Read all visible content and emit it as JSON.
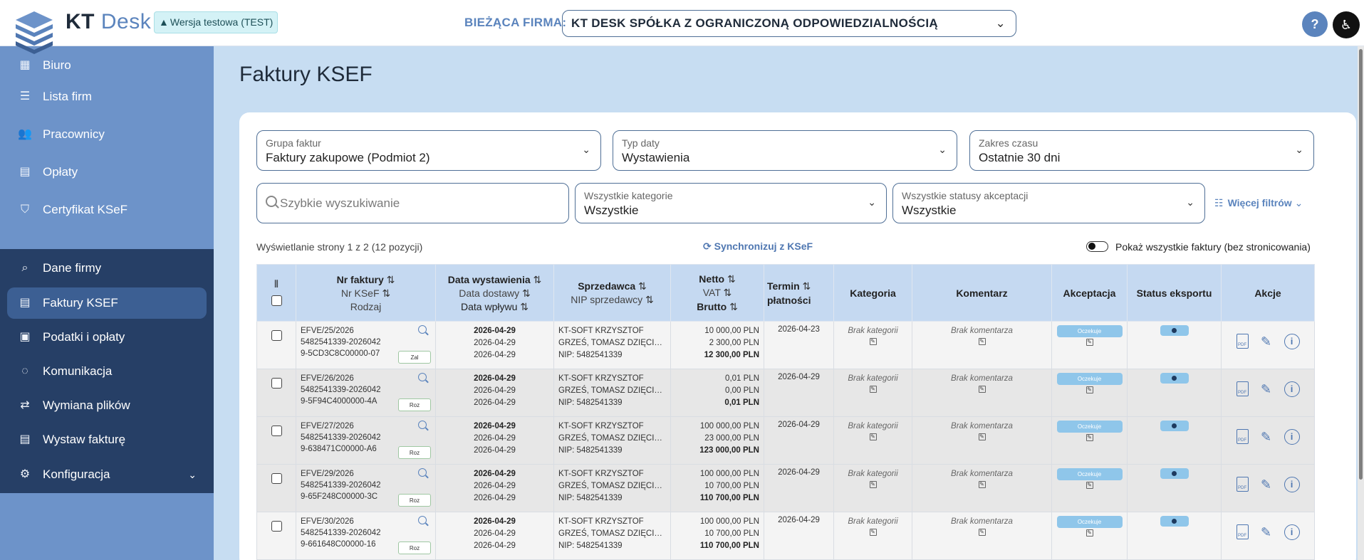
{
  "header": {
    "brand_main": "KT",
    "brand_accent": "Desk",
    "test_badge": "Wersja testowa (TEST)",
    "company_label": "BIEŻĄCA FIRMA:",
    "company_value": "KT DESK SPÓŁKA Z OGRANICZONĄ ODPOWIEDZIALNOŚCIĄ",
    "help_label": "?"
  },
  "sidebar": {
    "items": [
      {
        "label": "Biuro",
        "icon": "building-icon"
      },
      {
        "label": "Lista firm",
        "icon": "list-icon"
      },
      {
        "label": "Pracownicy",
        "icon": "people-icon"
      },
      {
        "label": "Opłaty",
        "icon": "receipt-icon"
      },
      {
        "label": "Certyfikat KSeF",
        "icon": "shield-icon"
      },
      {
        "label": "Dane firmy",
        "icon": "search-icon"
      },
      {
        "label": "Faktury KSEF",
        "icon": "document-icon"
      },
      {
        "label": "Podatki i opłaty",
        "icon": "money-icon"
      },
      {
        "label": "Komunikacja",
        "icon": "chat-icon"
      },
      {
        "label": "Wymiana plików",
        "icon": "file-exchange-icon"
      },
      {
        "label": "Wystaw fakturę",
        "icon": "invoice-icon"
      },
      {
        "label": "Konfiguracja",
        "icon": "gear-icon"
      }
    ],
    "active": "Faktury KSEF"
  },
  "main": {
    "title": "Faktury KSEF",
    "filters": {
      "group": {
        "label": "Grupa faktur",
        "value": "Faktury zakupowe (Podmiot 2)"
      },
      "date_type": {
        "label": "Typ daty",
        "value": "Wystawienia"
      },
      "range": {
        "label": "Zakres czasu",
        "value": "Ostatnie 30 dni"
      },
      "search_placeholder": "Szybkie wyszukiwanie",
      "category": {
        "label": "Wszystkie kategorie",
        "value": "Wszystkie"
      },
      "status": {
        "label": "Wszystkie statusy akceptacji",
        "value": "Wszystkie"
      },
      "more_filters": "Więcej filtrów"
    },
    "info": "Wyświetlanie strony 1 z 2 (12 pozycji)",
    "sync": "Synchronizuj z KSeF",
    "toggle_label": "Pokaż wszystkie faktury (bez stronicowania)",
    "columns": {
      "nr": "Nr faktury",
      "nr_ksef": "Nr KSeF",
      "rodzaj": "Rodzaj",
      "date_issue": "Data wystawienia",
      "date_delivery": "Data dostawy",
      "date_in": "Data wpływu",
      "seller": "Sprzedawca",
      "seller_nip": "NIP sprzedawcy",
      "netto": "Netto",
      "vat": "VAT",
      "brutto": "Brutto",
      "termin": "Termin",
      "platnosci": "płatności",
      "kategoria": "Kategoria",
      "komentarz": "Komentarz",
      "akceptacja": "Akceptacja",
      "status": "Status eksportu",
      "akcje": "Akcje"
    },
    "rows": [
      {
        "nr": "EFVE/25/2026",
        "ksef1": "5482541339-2026042",
        "ksef2": "9-5CD3C8C00000-07",
        "kind": "Zal",
        "d1": "2026-04-29",
        "d2": "2026-04-29",
        "d3": "2026-04-29",
        "s1": "KT-SOFT KRZYSZTOF",
        "s2": "GRZEŚ, TOMASZ DZIĘCIO...",
        "nip": "NIP: 5482541339",
        "netto": "10 000,00 PLN",
        "vat": "2 300,00 PLN",
        "brutto": "12 300,00 PLN",
        "termin": "2026-04-23",
        "kat": "Brak kategorii",
        "kom": "Brak komentarza",
        "akc": "Oczekuje"
      },
      {
        "nr": "EFVE/26/2026",
        "ksef1": "5482541339-2026042",
        "ksef2": "9-5F94C4000000-4A",
        "kind": "Roz",
        "d1": "2026-04-29",
        "d2": "2026-04-29",
        "d3": "2026-04-29",
        "s1": "KT-SOFT KRZYSZTOF",
        "s2": "GRZEŚ, TOMASZ DZIĘCIO...",
        "nip": "NIP: 5482541339",
        "netto": "0,01 PLN",
        "vat": "0,00 PLN",
        "brutto": "0,01 PLN",
        "termin": "2026-04-29",
        "kat": "Brak kategorii",
        "kom": "Brak komentarza",
        "akc": "Oczekuje"
      },
      {
        "nr": "EFVE/27/2026",
        "ksef1": "5482541339-2026042",
        "ksef2": "9-638471C00000-A6",
        "kind": "Roz",
        "d1": "2026-04-29",
        "d2": "2026-04-29",
        "d3": "2026-04-29",
        "s1": "KT-SOFT KRZYSZTOF",
        "s2": "GRZEŚ, TOMASZ DZIĘCIO...",
        "nip": "NIP: 5482541339",
        "netto": "100 000,00 PLN",
        "vat": "23 000,00 PLN",
        "brutto": "123 000,00 PLN",
        "termin": "2026-04-29",
        "kat": "Brak kategorii",
        "kom": "Brak komentarza",
        "akc": "Oczekuje"
      },
      {
        "nr": "EFVE/29/2026",
        "ksef1": "5482541339-2026042",
        "ksef2": "9-65F248C00000-3C",
        "kind": "Roz",
        "d1": "2026-04-29",
        "d2": "2026-04-29",
        "d3": "2026-04-29",
        "s1": "KT-SOFT KRZYSZTOF",
        "s2": "GRZEŚ, TOMASZ DZIĘCIO...",
        "nip": "NIP: 5482541339",
        "netto": "100 000,00 PLN",
        "vat": "10 700,00 PLN",
        "brutto": "110 700,00 PLN",
        "termin": "2026-04-29",
        "kat": "Brak kategorii",
        "kom": "Brak komentarza",
        "akc": "Oczekuje"
      },
      {
        "nr": "EFVE/30/2026",
        "ksef1": "5482541339-2026042",
        "ksef2": "9-661648C00000-16",
        "kind": "Roz",
        "d1": "2026-04-29",
        "d2": "2026-04-29",
        "d3": "2026-04-29",
        "s1": "KT-SOFT KRZYSZTOF",
        "s2": "GRZEŚ, TOMASZ DZIĘCIO...",
        "nip": "NIP: 5482541339",
        "netto": "100 000,00 PLN",
        "vat": "10 700,00 PLN",
        "brutto": "110 700,00 PLN",
        "termin": "2026-04-29",
        "kat": "Brak kategorii",
        "kom": "Brak komentarza",
        "akc": "Oczekuje"
      }
    ]
  },
  "colors": {
    "accent": "#5b84bd",
    "sidebar": "#6d93c9",
    "sidebar_dark": "#263f66",
    "header_row": "#c5d9f1"
  }
}
